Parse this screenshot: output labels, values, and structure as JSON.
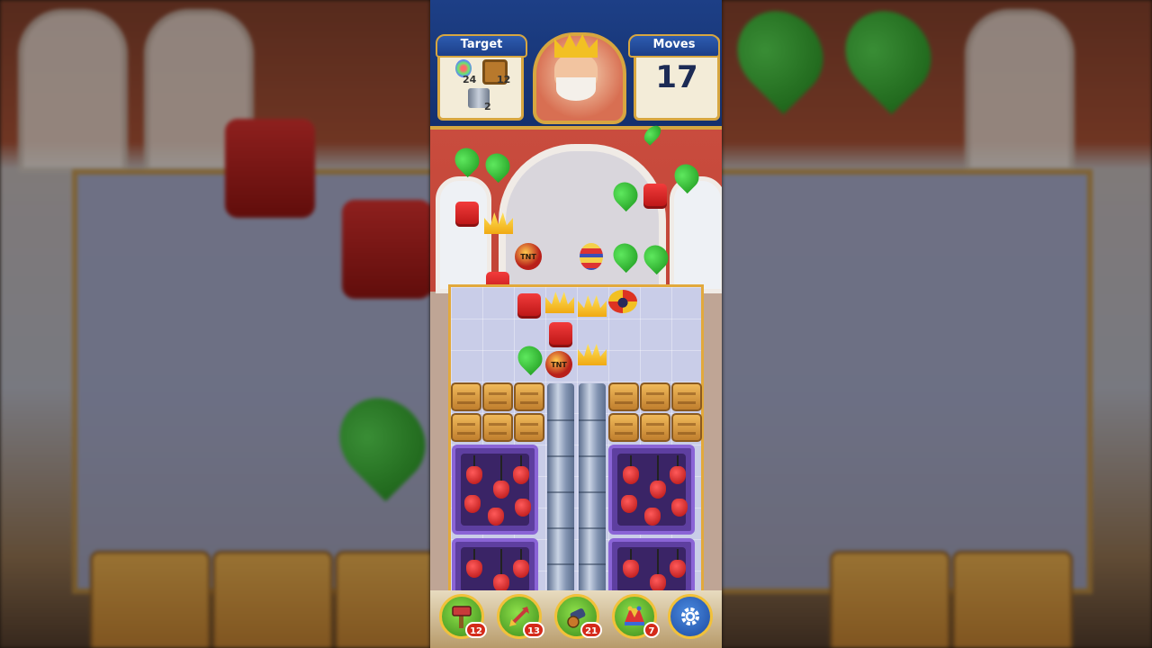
{
  "header": {
    "target_label": "Target",
    "moves_label": "Moves",
    "moves_value": "17"
  },
  "targets": [
    {
      "icon": "rainbow-potion-icon",
      "count": "24"
    },
    {
      "icon": "wooden-box-icon",
      "count": "12"
    },
    {
      "icon": "metal-pipe-icon",
      "count": "2"
    }
  ],
  "board_pieces": {
    "tnt_label": "TNT"
  },
  "boosters": [
    {
      "icon": "hammer-icon",
      "count": "12"
    },
    {
      "icon": "arrow-icon",
      "count": "13"
    },
    {
      "icon": "cannon-icon",
      "count": "21"
    },
    {
      "icon": "jester-hat-icon",
      "count": "7"
    },
    {
      "icon": "gear-icon",
      "count": ""
    }
  ],
  "colors": {
    "header_blue": "#1d3f86",
    "gold_border": "#d7a640",
    "board_bg": "#c9cde8",
    "room_red": "#c94c3e"
  }
}
